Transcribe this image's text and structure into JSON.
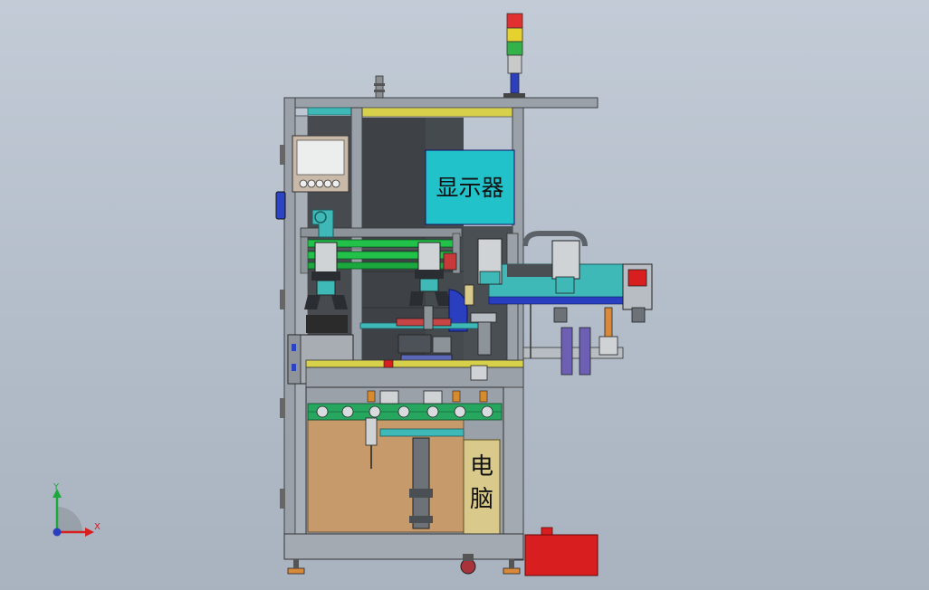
{
  "labels": {
    "monitor": "显示器",
    "computer_line1": "电",
    "computer_line2": "脑"
  },
  "triad": {
    "x_axis": "X",
    "y_axis": "Y"
  },
  "colors": {
    "background": "#b8c1cd",
    "frame": "#9aa1a8",
    "frame_dark": "#5c6268",
    "monitor_panel": "#21c2c9",
    "computer_panel": "#d9c98a",
    "cabinet": "#c79a6b",
    "rail_green": "#22c24a",
    "blue_plate": "#2a3fbf",
    "red_box": "#d81e1e",
    "accent_yellow": "#e6d640",
    "cyan_parts": "#3fb8b8"
  },
  "icons": {
    "stack_light": "signal-tower-icon",
    "triad": "axis-triad-icon"
  }
}
